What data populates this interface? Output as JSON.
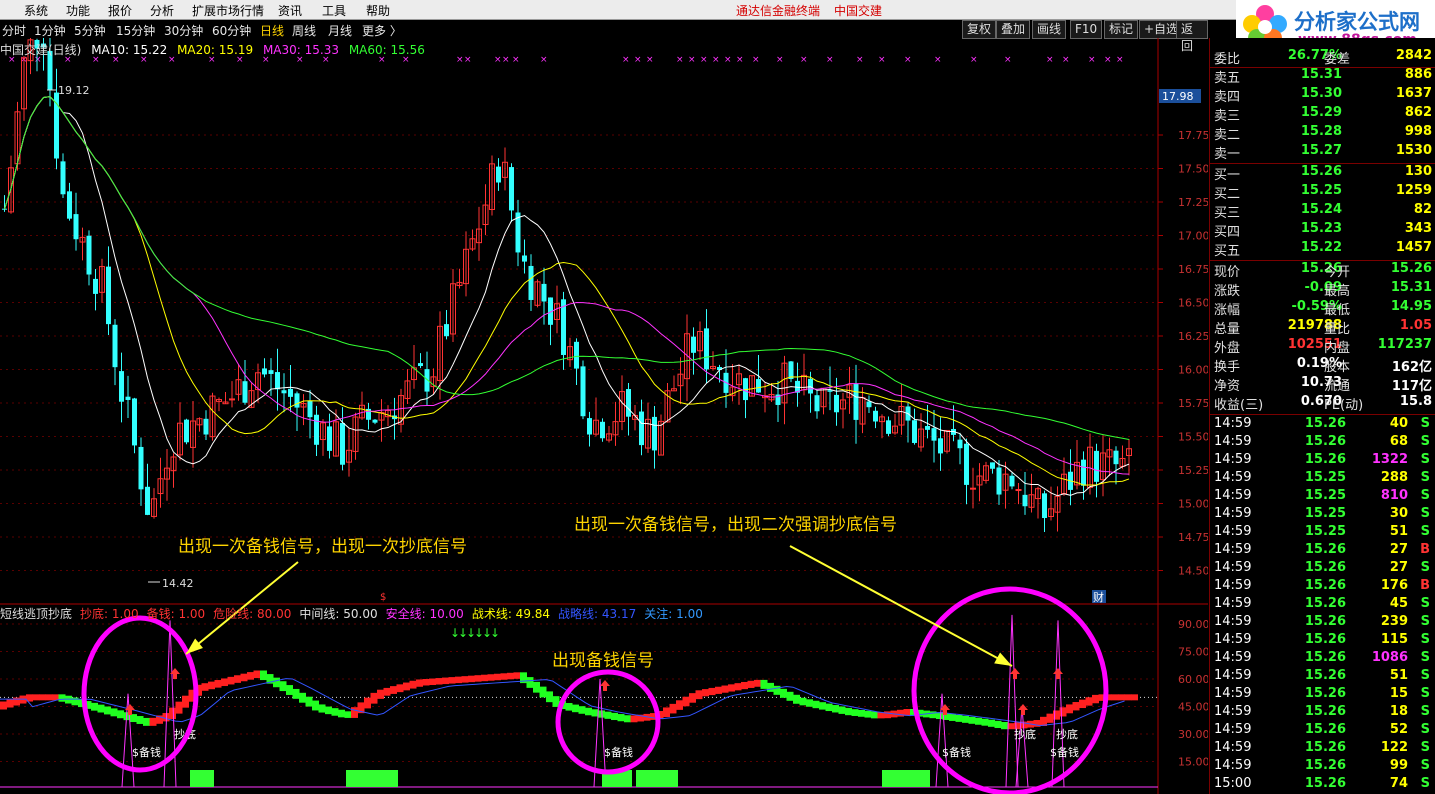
{
  "menubar": {
    "items": [
      "系统",
      "功能",
      "报价",
      "分析",
      "扩展市场行情",
      "资讯",
      "工具",
      "帮助"
    ],
    "app_title": "通达信金融终端",
    "stock_title": "中国交建",
    "logo_name": "分析家公式网",
    "logo_url": "www.88gs.com"
  },
  "period_bar": {
    "items": [
      "分时",
      "1分钟",
      "5分钟",
      "15分钟",
      "30分钟",
      "60分钟",
      "日线",
      "周线",
      "月线",
      "更多 〉"
    ],
    "active": "日线",
    "tools": [
      "复权",
      "叠加",
      "画线",
      "F10",
      "标记",
      "+自选",
      "返回"
    ]
  },
  "legend": {
    "label": "中国交建(日线)",
    "ma10": "MA10: 15.22",
    "ma20": "MA20: 15.19",
    "ma30": "MA30: 15.33",
    "ma60": "MA60: 15.56"
  },
  "colors": {
    "ma10": "#ffffff",
    "ma20": "#ffff00",
    "ma30": "#ff33ff",
    "ma60": "#33ff33",
    "up": "#ff3333",
    "down": "#33ffff"
  },
  "price_axis": {
    "labels": [
      "17.75",
      "17.50",
      "17.25",
      "17.00",
      "16.75",
      "16.50",
      "16.25",
      "16.00",
      "15.75",
      "15.50",
      "15.25",
      "15.00",
      "14.75",
      "14.50"
    ],
    "current": "17.98"
  },
  "price_marks": {
    "high": "19.12",
    "low": "14.42",
    "cai": "财"
  },
  "indicator": {
    "name": "短线逃顶抄底",
    "params": [
      {
        "t": "抄底: 1.00",
        "c": "#ff3333"
      },
      {
        "t": "备钱: 1.00",
        "c": "#ff3333"
      },
      {
        "t": "危险线: 80.00",
        "c": "#ff3333"
      },
      {
        "t": "中间线: 50.00",
        "c": "#e0e0e0"
      },
      {
        "t": "安全线: 10.00",
        "c": "#ff33ff"
      },
      {
        "t": "战术线: 49.84",
        "c": "#ffff00"
      },
      {
        "t": "战略线: 43.17",
        "c": "#3355ff"
      },
      {
        "t": "关注: 1.00",
        "c": "#3399ff"
      }
    ],
    "axis": [
      "90.00",
      "75.00",
      "60.00",
      "45.00",
      "30.00",
      "15.00"
    ],
    "labels": [
      "$备钱",
      "抄底",
      "$备钱",
      "$备钱",
      "抄底",
      "$备钱",
      "抄底"
    ]
  },
  "annotations": {
    "a1": "出现一次备钱信号，出现一次抄底信号",
    "a2": "出现一次备钱信号，出现二次强调抄底信号",
    "a3": "出现备钱信号"
  },
  "quote": {
    "wei": {
      "label": "委比",
      "value": "26.77%",
      "label2": "委差",
      "value2": "2842"
    },
    "sells": [
      {
        "label": "卖五",
        "price": "15.31",
        "vol": "886"
      },
      {
        "label": "卖四",
        "price": "15.30",
        "vol": "1637"
      },
      {
        "label": "卖三",
        "price": "15.29",
        "vol": "862"
      },
      {
        "label": "卖二",
        "price": "15.28",
        "vol": "998"
      },
      {
        "label": "卖一",
        "price": "15.27",
        "vol": "1530"
      }
    ],
    "buys": [
      {
        "label": "买一",
        "price": "15.26",
        "vol": "130"
      },
      {
        "label": "买二",
        "price": "15.25",
        "vol": "1259"
      },
      {
        "label": "买三",
        "price": "15.24",
        "vol": "82"
      },
      {
        "label": "买四",
        "price": "15.23",
        "vol": "343"
      },
      {
        "label": "买五",
        "price": "15.22",
        "vol": "1457"
      }
    ],
    "stats": [
      {
        "l1": "现价",
        "v1": "15.26",
        "c1": "#33ff33",
        "l2": "今开",
        "v2": "15.26",
        "c2": "#33ff33"
      },
      {
        "l1": "涨跌",
        "v1": "-0.09",
        "c1": "#33ff33",
        "l2": "最高",
        "v2": "15.31",
        "c2": "#33ff33"
      },
      {
        "l1": "涨幅",
        "v1": "-0.59%",
        "c1": "#33ff33",
        "l2": "最低",
        "v2": "14.95",
        "c2": "#33ff33"
      },
      {
        "l1": "总量",
        "v1": "219788",
        "c1": "#ffff00",
        "l2": "量比",
        "v2": "1.05",
        "c2": "#ff3333"
      },
      {
        "l1": "外盘",
        "v1": "102551",
        "c1": "#ff3333",
        "l2": "内盘",
        "v2": "117237",
        "c2": "#33ff33"
      },
      {
        "l1": "换手",
        "v1": "0.19%",
        "c1": "#ffffff",
        "l2": "股本",
        "v2": "162亿",
        "c2": "#ffffff"
      },
      {
        "l1": "净资",
        "v1": "10.73",
        "c1": "#ffffff",
        "l2": "流通",
        "v2": "117亿",
        "c2": "#ffffff"
      },
      {
        "l1": "收益(三)",
        "v1": "0.670",
        "c1": "#ffffff",
        "l2": "PE(动)",
        "v2": "15.8",
        "c2": "#ffffff"
      }
    ],
    "ticks": [
      {
        "t": "14:59",
        "p": "15.26",
        "q": "40",
        "s": "S"
      },
      {
        "t": "14:59",
        "p": "15.26",
        "q": "68",
        "s": "S"
      },
      {
        "t": "14:59",
        "p": "15.26",
        "q": "1322",
        "s": "S"
      },
      {
        "t": "14:59",
        "p": "15.25",
        "q": "288",
        "s": "S"
      },
      {
        "t": "14:59",
        "p": "15.25",
        "q": "810",
        "s": "S"
      },
      {
        "t": "14:59",
        "p": "15.25",
        "q": "30",
        "s": "S"
      },
      {
        "t": "14:59",
        "p": "15.25",
        "q": "51",
        "s": "S"
      },
      {
        "t": "14:59",
        "p": "15.26",
        "q": "27",
        "s": "B"
      },
      {
        "t": "14:59",
        "p": "15.26",
        "q": "27",
        "s": "S"
      },
      {
        "t": "14:59",
        "p": "15.26",
        "q": "176",
        "s": "B"
      },
      {
        "t": "14:59",
        "p": "15.26",
        "q": "45",
        "s": "S"
      },
      {
        "t": "14:59",
        "p": "15.26",
        "q": "239",
        "s": "S"
      },
      {
        "t": "14:59",
        "p": "15.26",
        "q": "115",
        "s": "S"
      },
      {
        "t": "14:59",
        "p": "15.26",
        "q": "1086",
        "s": "S"
      },
      {
        "t": "14:59",
        "p": "15.26",
        "q": "51",
        "s": "S"
      },
      {
        "t": "14:59",
        "p": "15.26",
        "q": "15",
        "s": "S"
      },
      {
        "t": "14:59",
        "p": "15.26",
        "q": "18",
        "s": "S"
      },
      {
        "t": "14:59",
        "p": "15.26",
        "q": "52",
        "s": "S"
      },
      {
        "t": "14:59",
        "p": "15.26",
        "q": "122",
        "s": "S"
      },
      {
        "t": "14:59",
        "p": "15.26",
        "q": "99",
        "s": "S"
      },
      {
        "t": "15:00",
        "p": "15.26",
        "q": "74",
        "s": "S"
      }
    ]
  }
}
